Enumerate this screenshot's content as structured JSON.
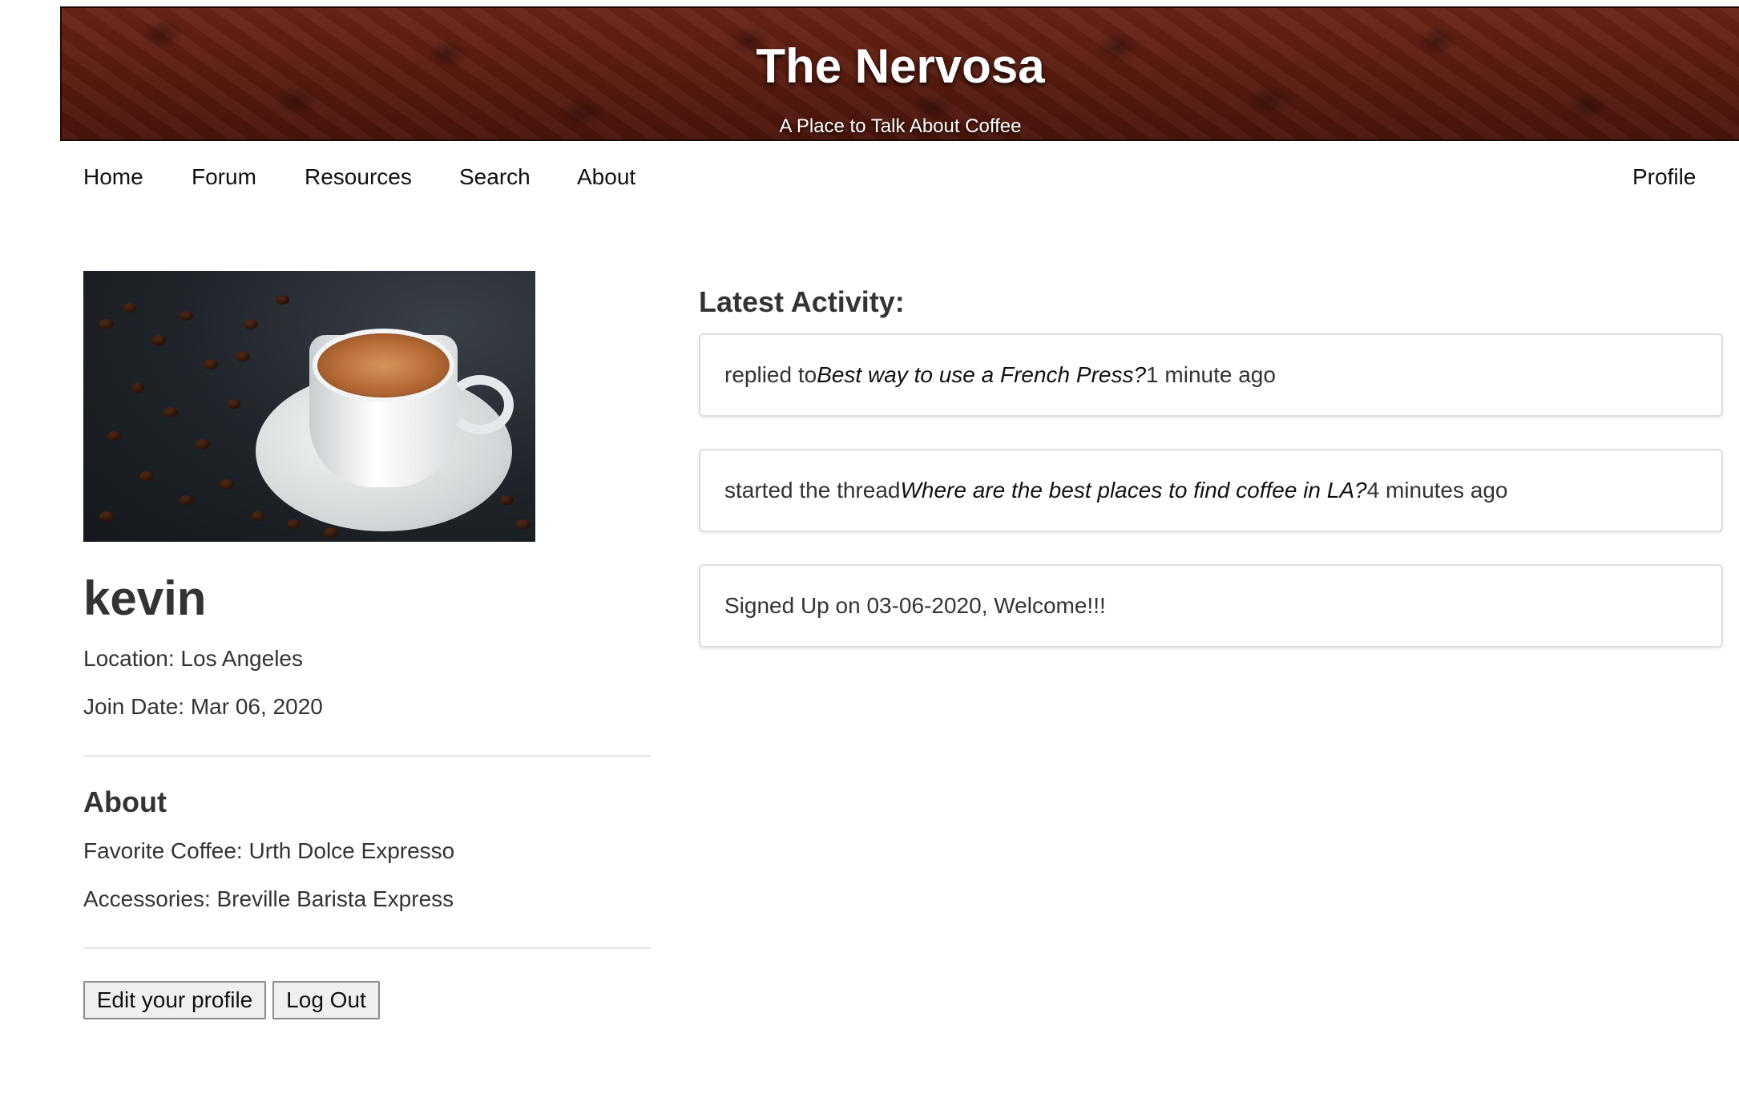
{
  "header": {
    "title": "The Nervosa",
    "subtitle": "A Place to Talk About Coffee"
  },
  "nav": {
    "items": [
      "Home",
      "Forum",
      "Resources",
      "Search",
      "About"
    ],
    "profile_label": "Profile"
  },
  "profile": {
    "username": "kevin",
    "location": "Location: Los Angeles",
    "join_date": "Join Date: Mar 06, 2020",
    "about_heading": "About",
    "favorite_coffee": "Favorite Coffee: Urth Dolce Expresso",
    "accessories": "Accessories: Breville Barista Express",
    "edit_button": "Edit your profile",
    "logout_button": "Log Out"
  },
  "activity": {
    "heading": "Latest Activity:",
    "items": [
      {
        "prefix": "replied to ",
        "subject": "Best way to use a French Press?",
        "suffix": " 1 minute ago"
      },
      {
        "prefix": "started the thread ",
        "subject": "Where are the best places to find coffee in LA?",
        "suffix": " 4 minutes ago"
      },
      {
        "prefix": "Signed Up on 03-06-2020, Welcome!!!",
        "subject": "",
        "suffix": ""
      }
    ]
  },
  "colors": {
    "banner": "#5a1c10",
    "text": "#333333",
    "card_border": "#dddddd"
  }
}
